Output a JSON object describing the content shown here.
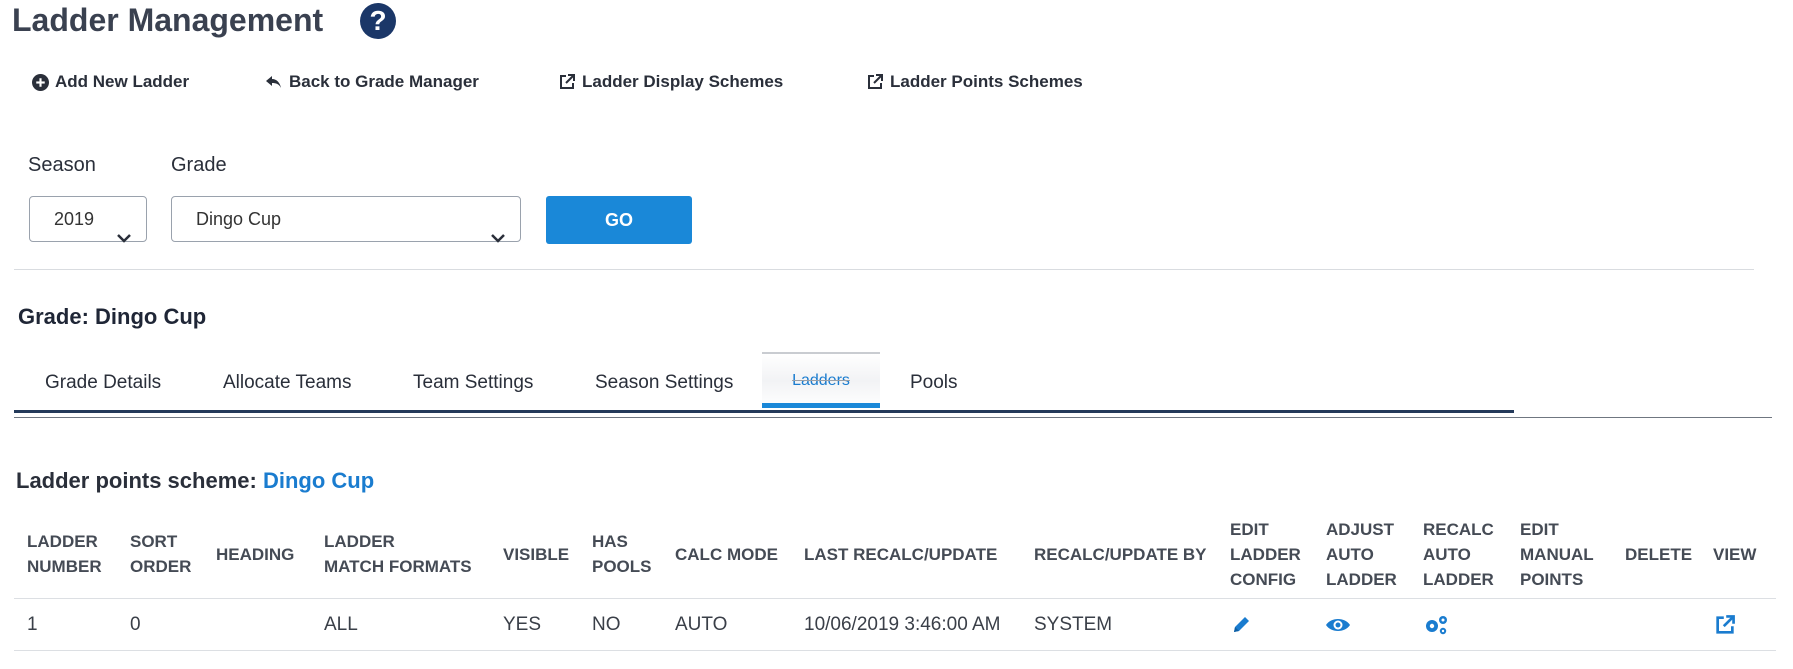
{
  "header": {
    "title": "Ladder Management",
    "help_glyph": "?"
  },
  "toolbar": {
    "add_new_ladder": "Add New Ladder",
    "back_to_grade_manager": "Back to Grade Manager",
    "ladder_display_schemes": "Ladder Display Schemes",
    "ladder_points_schemes": "Ladder Points Schemes"
  },
  "filters": {
    "season_label": "Season",
    "season_value": "2019",
    "grade_label": "Grade",
    "grade_value": "Dingo Cup",
    "go_label": "GO"
  },
  "grade": {
    "title": "Grade: Dingo Cup"
  },
  "tabs": [
    {
      "label": "Grade Details"
    },
    {
      "label": "Allocate Teams"
    },
    {
      "label": "Team Settings"
    },
    {
      "label": "Season Settings"
    },
    {
      "label": "Ladders",
      "active": true
    },
    {
      "label": "Pools"
    }
  ],
  "scheme": {
    "label": "Ladder points scheme:",
    "value": "Dingo Cup"
  },
  "table": {
    "columns": [
      [
        "LADDER",
        "NUMBER"
      ],
      [
        "SORT",
        "ORDER"
      ],
      [
        "HEADING"
      ],
      [
        "LADDER",
        "MATCH FORMATS"
      ],
      [
        "VISIBLE"
      ],
      [
        "HAS",
        "POOLS"
      ],
      [
        "CALC MODE"
      ],
      [
        "LAST RECALC/UPDATE"
      ],
      [
        "RECALC/UPDATE BY"
      ],
      [
        "EDIT",
        "LADDER",
        "CONFIG"
      ],
      [
        "ADJUST",
        "AUTO",
        "LADDER"
      ],
      [
        "RECALC",
        "AUTO",
        "LADDER"
      ],
      [
        "EDIT",
        "MANUAL",
        "POINTS"
      ],
      [
        "DELETE"
      ],
      [
        "VIEW"
      ]
    ],
    "rows": [
      {
        "ladder_number": "1",
        "sort_order": "0",
        "heading": "",
        "match_formats": "ALL",
        "visible": "YES",
        "has_pools": "NO",
        "calc_mode": "AUTO",
        "last_recalc": "10/06/2019 3:46:00 AM",
        "recalc_by": "SYSTEM",
        "icons": {
          "edit_config": "pencil-icon",
          "adjust_auto": "eye-icon",
          "recalc_auto": "gears-icon",
          "view": "external-link-icon"
        }
      }
    ]
  },
  "colors": {
    "accent": "#1a88d8",
    "link": "#1a7ccf",
    "help": "#1b3768"
  }
}
